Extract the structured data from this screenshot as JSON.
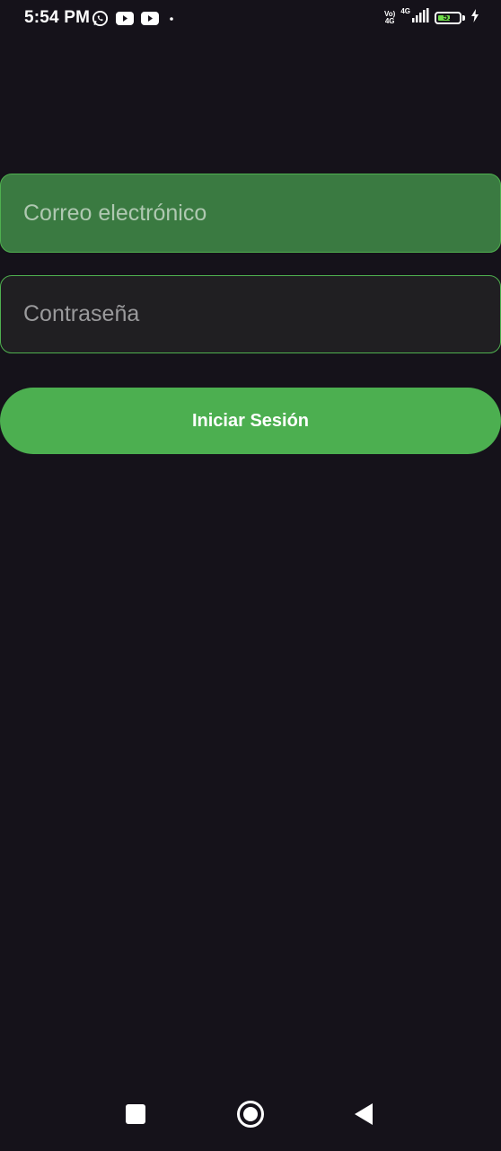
{
  "status_bar": {
    "time": "5:54 PM",
    "left_icons": [
      "whatsapp-icon",
      "youtube-icon",
      "youtube-icon",
      "dot-icon"
    ],
    "network_label_1": "Vo)",
    "network_label_1b": "4G",
    "network_label_2": "4G",
    "battery_level": "51",
    "battery_color": "#6fdc4a",
    "charging_icon": "bolt-icon"
  },
  "login_form": {
    "email": {
      "value": "",
      "placeholder": "Correo electrónico"
    },
    "password": {
      "value": "",
      "placeholder": "Contraseña"
    },
    "submit_label": "Iniciar Sesión"
  },
  "colors": {
    "background": "#15121a",
    "accent": "#4caf50",
    "email_field_bg": "#3a7a41",
    "password_field_bg": "#201f22"
  },
  "nav_bar": {
    "recents_icon": "square-icon",
    "home_icon": "circle-icon",
    "back_icon": "triangle-back-icon"
  }
}
